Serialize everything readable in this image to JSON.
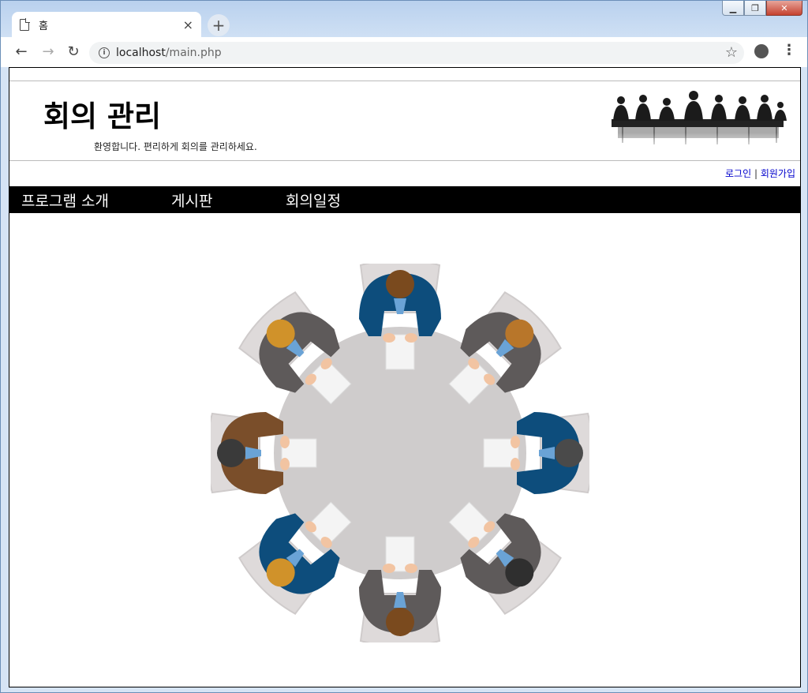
{
  "browser": {
    "tab_title": "홈",
    "url_host": "localhost",
    "url_path": "/main.php",
    "info_glyph": "i",
    "new_tab_glyph": "+",
    "tab_close_glyph": "×"
  },
  "header": {
    "title": "회의 관리",
    "subtitle": "환영합니다. 편리하게 회의를 관리하세요.",
    "image": "meeting-silhouette-banner"
  },
  "auth": {
    "login": "로그인",
    "separator": "|",
    "signup": "회원가입"
  },
  "nav": {
    "items": [
      {
        "label": "프로그램 소개"
      },
      {
        "label": "게시판"
      },
      {
        "label": "회의일정"
      }
    ]
  },
  "main": {
    "image": "round-table-meeting-illustration"
  },
  "colors": {
    "nav_bg": "#000000",
    "link": "#0000cc",
    "table": "#cfcccc",
    "suit_blue": "#0d4d7c",
    "suit_gray": "#5e5a5a",
    "suit_brown": "#7a4e2a"
  }
}
